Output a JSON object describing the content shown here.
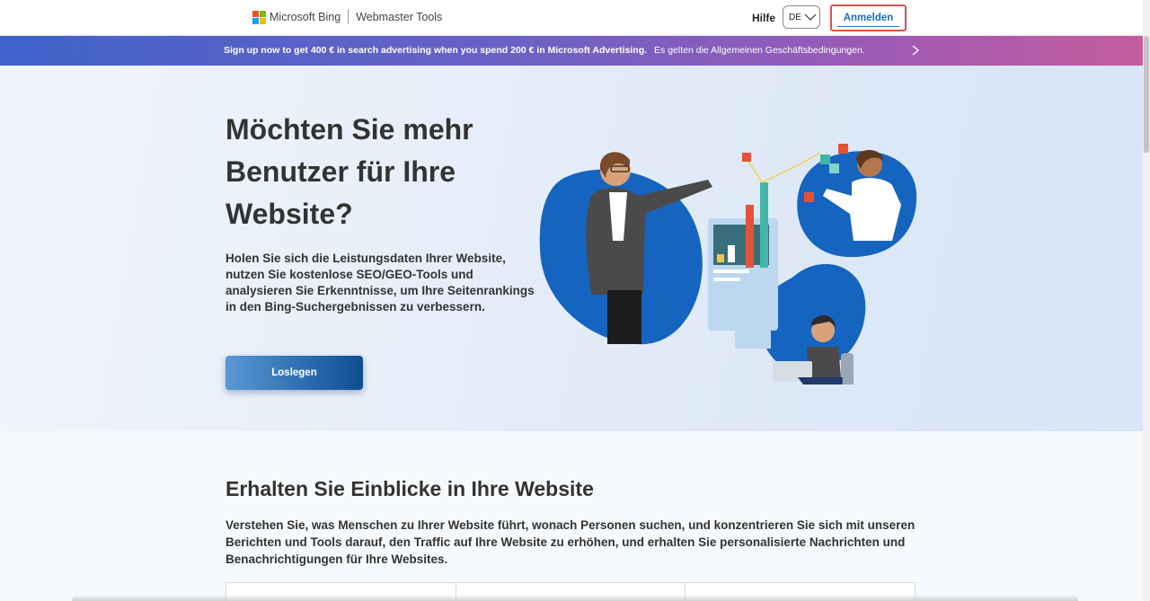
{
  "header": {
    "brand_name": "Microsoft Bing",
    "product_name": "Webmaster Tools",
    "help_label": "Hilfe",
    "language_value": "DE",
    "signin_label": "Anmelden",
    "logo_colors": [
      "#f25022",
      "#7fba00",
      "#00a4ef",
      "#ffb900"
    ]
  },
  "promo": {
    "text": "Sign up now to get 400 € in search advertising when you spend 200 € in Microsoft Advertising.",
    "terms": "Es gelten die Allgemeinen Geschäftsbedingungen.",
    "arrow_icon": "chevron-right-icon"
  },
  "hero": {
    "title": "Möchten Sie mehr Benutzer für Ihre Website?",
    "description": "Holen Sie sich die Leistungsdaten Ihrer Website, nutzen Sie kostenlose SEO/GEO-Tools und analysieren Sie Erkenntnisse, um Ihre Seitenrankings in den Bing-Suchergebnissen zu verbessern.",
    "cta_label": "Loslegen"
  },
  "insights": {
    "title": "Erhalten Sie Einblicke in Ihre Website",
    "text": "Verstehen Sie, was Menschen zu Ihrer Website führt, wonach Personen suchen, und konzentrieren Sie sich mit unseren Berichten und Tools darauf, den Traffic auf Ihre Website zu erhöhen, und erhalten Sie personalisierte Nachrichten und Benachrichtigungen für Ihre Websites."
  },
  "colors": {
    "accent_blue": "#1a6fc6",
    "cta_dark": "#0f4e91",
    "highlight_red": "#d9534f"
  }
}
